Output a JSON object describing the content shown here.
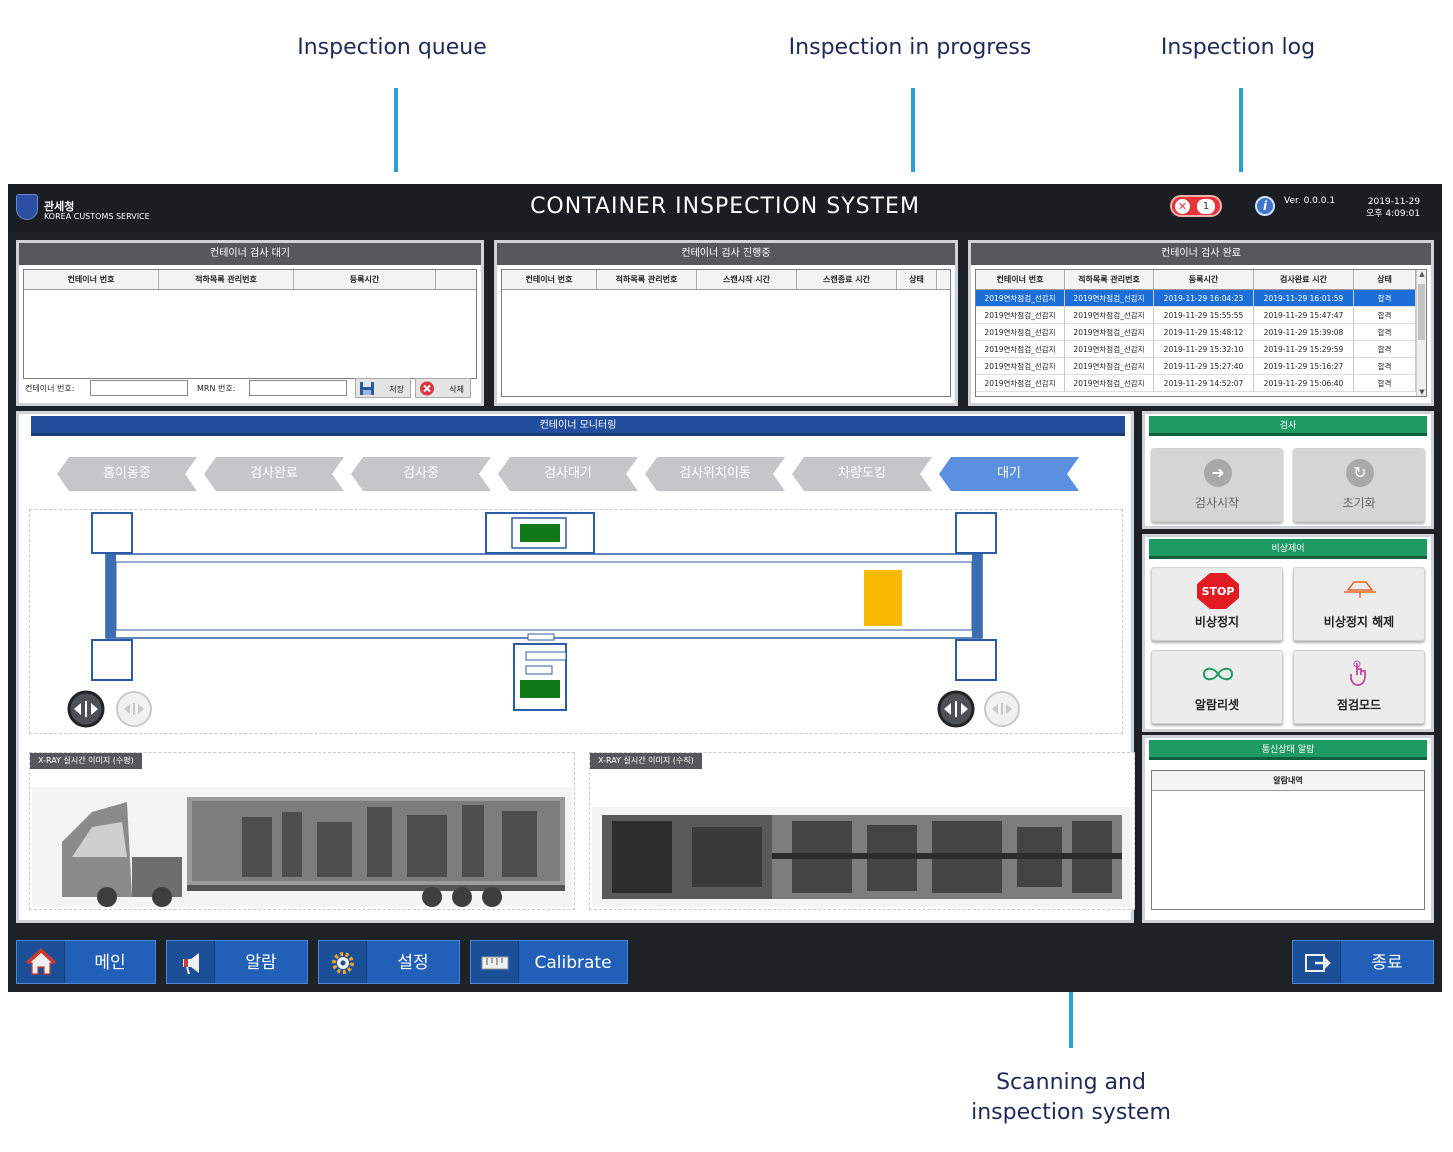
{
  "annotations": {
    "queue": "Inspection queue",
    "progress": "Inspection in progress",
    "log": "Inspection log",
    "scanning": "Scanning and inspection system"
  },
  "header": {
    "org_ko": "관세청",
    "org_en": "KOREA CUSTOMS SERVICE",
    "title": "CONTAINER INSPECTION SYSTEM",
    "alarm_count": "1",
    "version": "Ver. 0.0.0.1",
    "date": "2019-11-29",
    "time": "오후 4:09:01"
  },
  "queue": {
    "title": "컨테이너 검사 대기",
    "columns": [
      "컨테이너 번호",
      "적하목록 관리번호",
      "등록시간"
    ],
    "container_label": "컨테이너 번호:",
    "mrn_label": "MRN 번호:",
    "save_label": "저장",
    "delete_label": "삭제"
  },
  "progress": {
    "title": "컨테이너 검사 진행중",
    "columns": [
      "컨테이너 번호",
      "적하목록 관리번호",
      "스캔시작 시간",
      "스캔종료 시간",
      "상태"
    ]
  },
  "log": {
    "title": "컨테이너 검사 완료",
    "columns": [
      "컨테이너 번호",
      "적하목록 관리번호",
      "등록시간",
      "검사완료 시간",
      "상태"
    ],
    "rows": [
      [
        "2019연차점검_선감지",
        "2019연차점검_선감지",
        "2019-11-29 16:04:23",
        "2019-11-29 16:01:59",
        "합격"
      ],
      [
        "2019연차점검_선감지",
        "2019연차점검_선감지",
        "2019-11-29 15:55:55",
        "2019-11-29 15:47:47",
        "합격"
      ],
      [
        "2019연차점검_선감지",
        "2019연차점검_선감지",
        "2019-11-29 15:48:12",
        "2019-11-29 15:39:08",
        "합격"
      ],
      [
        "2019연차점검_선감지",
        "2019연차점검_선감지",
        "2019-11-29 15:32:10",
        "2019-11-29 15:29:59",
        "합격"
      ],
      [
        "2019연차점검_선감지",
        "2019연차점검_선감지",
        "2019-11-29 15:27:40",
        "2019-11-29 15:16:27",
        "합격"
      ],
      [
        "2019연차점검_선감지",
        "2019연차점검_선감지",
        "2019-11-29 14:52:07",
        "2019-11-29 15:06:40",
        "합격"
      ]
    ]
  },
  "monitor": {
    "title": "컨테이너 모니터링",
    "steps": [
      "홈이동중",
      "검사완료",
      "검사중",
      "검사대기",
      "검사위치이동",
      "차량도킹",
      "대기"
    ],
    "active_step": 6,
    "xray_h_label": "X-RAY 실시간 이미지 (수평)",
    "xray_v_label": "X-RAY 실시간 이미지 (수직)"
  },
  "inspect": {
    "title": "검사",
    "start_label": "검사시작",
    "reset_label": "초기화"
  },
  "emergency": {
    "title": "비상제어",
    "stop_label": "비상정지",
    "stop_sign": "STOP",
    "release_label": "비상정지 해제",
    "alarm_reset_label": "알람리셋",
    "check_mode_label": "점검모드"
  },
  "comm": {
    "title": "통신상태 알람",
    "column": "알람내역"
  },
  "nav": {
    "main": "메인",
    "alarm": "알람",
    "settings": "설정",
    "calibrate": "Calibrate",
    "exit": "종료"
  },
  "colors": {
    "accent_blue": "#2160b6",
    "green_head": "#1e9b62",
    "stop_red": "#e7333c",
    "sensor_green": "#0f7a17",
    "container_marker": "#f7b900"
  }
}
